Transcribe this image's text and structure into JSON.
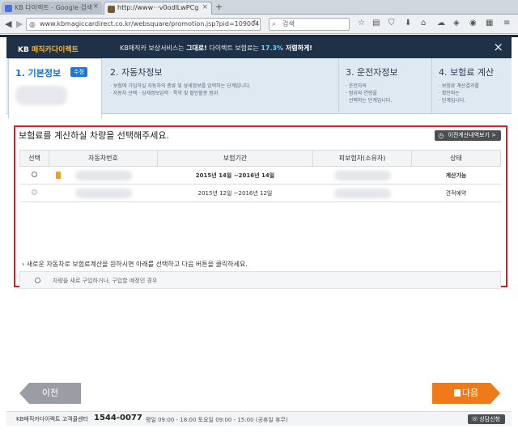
{
  "browser": {
    "tabs": [
      {
        "label": "KB 다이렉트 - Google 검색"
      },
      {
        "label": "http://www···v0odlLwPCg"
      }
    ],
    "url": "www.kbmagiccardirect.co.kr/websquare/promotion.jsp?pid=109004",
    "search_placeholder": "검색"
  },
  "promo": {
    "logo_prefix": "KB",
    "logo_brand": "매직카다이렉트",
    "text_start": "KB매직카 보상서비스는 ",
    "text_strong": "그대로!",
    "text_mid": " 다이렉트 보험료는 ",
    "text_highlight": "17.3%",
    "text_end": " 저렴하게!"
  },
  "steps": [
    {
      "title": "1. 기본정보",
      "badge": "수정",
      "desc": ""
    },
    {
      "title": "2. 자동차정보",
      "desc_line1": "· 보험에 가입하실 자동차의 종류 및 상세정보를 입력하는 단계입니다.",
      "desc_line2": "· 자동차 선택          · 상세정보입력          · 특약 및 할인할증 범위"
    },
    {
      "title": "3. 운전자정보",
      "desc_line1": "· 운전자의",
      "desc_line2": "· 범위와 연령을",
      "desc_line3": "· 선택하는 단계입니다."
    },
    {
      "title": "4. 보험료 계산",
      "desc_line1": "· 보험료 계산결과를",
      "desc_line2": "· 확인하는",
      "desc_line3": "· 단계입니다."
    }
  ],
  "selection": {
    "title": "보험료를 계산하실 차량을 선택해주세요.",
    "history_button": "이전계산내역보기 >",
    "columns": [
      "선택",
      "자동차번호",
      "보험기간",
      "피보험자(소유자)",
      "상태"
    ],
    "rows": [
      {
        "period": "2015년     14일 ~2016년     14일",
        "status": "계산가능",
        "enabled": true
      },
      {
        "period": "2015년     12일 ~2016년     12일",
        "status": "견적예약",
        "enabled": false
      }
    ],
    "new_car_note": "› 새로운 자동차로 보험료계산을 원하시면 아래를 선택하고 다음 버튼을 클릭하세요.",
    "new_car_option": "차량을 새로 구입하거나, 구입할 예정인 경우"
  },
  "nav": {
    "prev": "이전",
    "next": "다음"
  },
  "footer": {
    "brand": "KB매직카다이렉트 고객콜센터",
    "phone": "1544-0077",
    "hours": "평일 09:00 - 18:00   토요일 09:00 - 15:00 (공휴일 휴무)",
    "consult": "상담신청"
  },
  "colors": {
    "accent_red": "#d21f2a",
    "next_orange": "#ef7a1a",
    "link_blue": "#1a6fbf"
  }
}
